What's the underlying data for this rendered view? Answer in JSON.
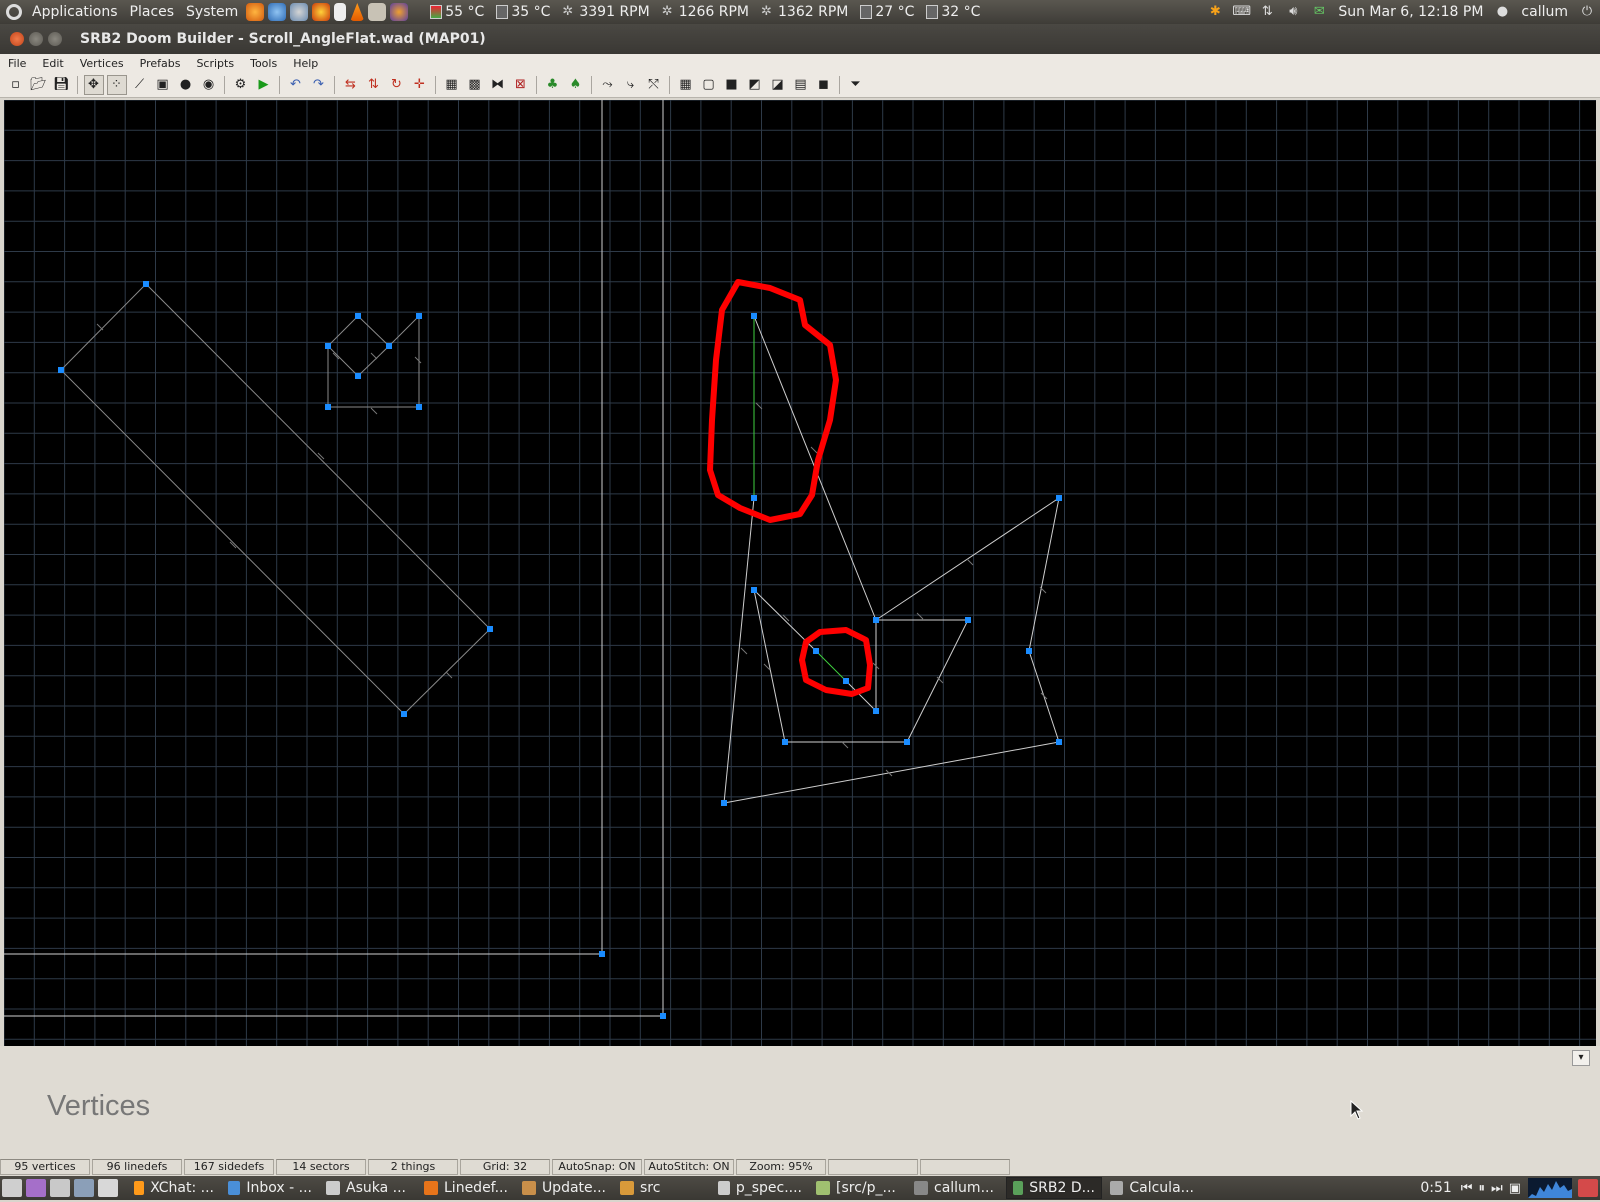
{
  "top_panel": {
    "menus": [
      "Applications",
      "Places",
      "System"
    ],
    "sensors": [
      {
        "label": "55 °C",
        "icon": "thermometer-icon"
      },
      {
        "label": "35 °C",
        "icon": "hdd-temp-icon"
      },
      {
        "label": "3391 RPM",
        "icon": "fan-icon"
      },
      {
        "label": "1266 RPM",
        "icon": "fan-icon"
      },
      {
        "label": "1362 RPM",
        "icon": "fan-icon"
      },
      {
        "label": "27 °C",
        "icon": "hdd-temp-icon"
      },
      {
        "label": "32 °C",
        "icon": "hdd-temp-icon"
      }
    ],
    "clock": "Sun Mar  6, 12:18 PM",
    "user": "callum"
  },
  "window": {
    "title": "SRB2 Doom Builder - Scroll_AngleFlat.wad (MAP01)"
  },
  "menubar": {
    "items": [
      "File",
      "Edit",
      "Vertices",
      "Prefabs",
      "Scripts",
      "Tools",
      "Help"
    ]
  },
  "toolbar": {
    "icons": [
      "new-map-icon",
      "open-map-icon",
      "save-map-icon",
      "sep",
      "move-mode-icon",
      "vertices-mode-icon",
      "linedefs-mode-icon",
      "sectors-mode-icon",
      "things-mode-icon",
      "3d-mode-icon",
      "sep",
      "prefab-icon",
      "test-map-icon",
      "sep",
      "undo-icon",
      "redo-icon",
      "sep",
      "flip-linedef-icon",
      "flip-vertical-icon",
      "rotate-icon",
      "snap-icon",
      "sep",
      "grid-icon",
      "grid-toggle-icon",
      "merge-icon",
      "delete-icon",
      "sep",
      "tree-icon",
      "tree-alt-icon",
      "sep",
      "curve-icon",
      "split-icon",
      "join-icon",
      "sep",
      "view-1-icon",
      "view-2-icon",
      "view-3-icon",
      "view-4-icon",
      "view-5-icon",
      "view-6-icon",
      "view-7-icon",
      "sep",
      "filter-icon"
    ],
    "selected": [
      "move-mode-icon",
      "vertices-mode-icon"
    ]
  },
  "map": {
    "grid_color": "#2e3a48",
    "line_color": "#cfcfcf",
    "vertex_color": "#1a8cff",
    "highlight_color": "#3fd13f",
    "annotation_color": "#ff0000"
  },
  "panel": {
    "mode_label": "Vertices"
  },
  "statusbar": {
    "cells": [
      "95 vertices",
      "96 linedefs",
      "167 sidedefs",
      "14 sectors",
      "2 things",
      "Grid: 32",
      "AutoSnap: ON",
      "AutoStitch: ON",
      "Zoom: 95%",
      "",
      ""
    ]
  },
  "taskbar": {
    "tasks": [
      {
        "label": "XChat: ...",
        "icon": "xchat-icon",
        "color": "#ff9a1a"
      },
      {
        "label": "Inbox - ...",
        "icon": "mail-icon",
        "color": "#4a8fd8"
      },
      {
        "label": "Asuka ...",
        "icon": "image-viewer-icon",
        "color": "#cccccc"
      },
      {
        "label": "Linedef...",
        "icon": "firefox-icon",
        "color": "#e8741a"
      },
      {
        "label": "Update...",
        "icon": "package-icon",
        "color": "#c98f4a"
      },
      {
        "label": "src",
        "icon": "folder-icon",
        "color": "#d99a3a"
      },
      {
        "label": "p_spec....",
        "icon": "text-editor-icon",
        "color": "#cccccc"
      },
      {
        "label": "[src/p_...",
        "icon": "meld-icon",
        "color": "#a0c070"
      },
      {
        "label": "callum...",
        "icon": "terminal-icon",
        "color": "#888888"
      },
      {
        "label": "SRB2 D...",
        "icon": "doombuilder-icon",
        "color": "#5aa05a"
      },
      {
        "label": "Calcula...",
        "icon": "calculator-icon",
        "color": "#aaaaaa"
      }
    ],
    "media_time": "0:51"
  }
}
